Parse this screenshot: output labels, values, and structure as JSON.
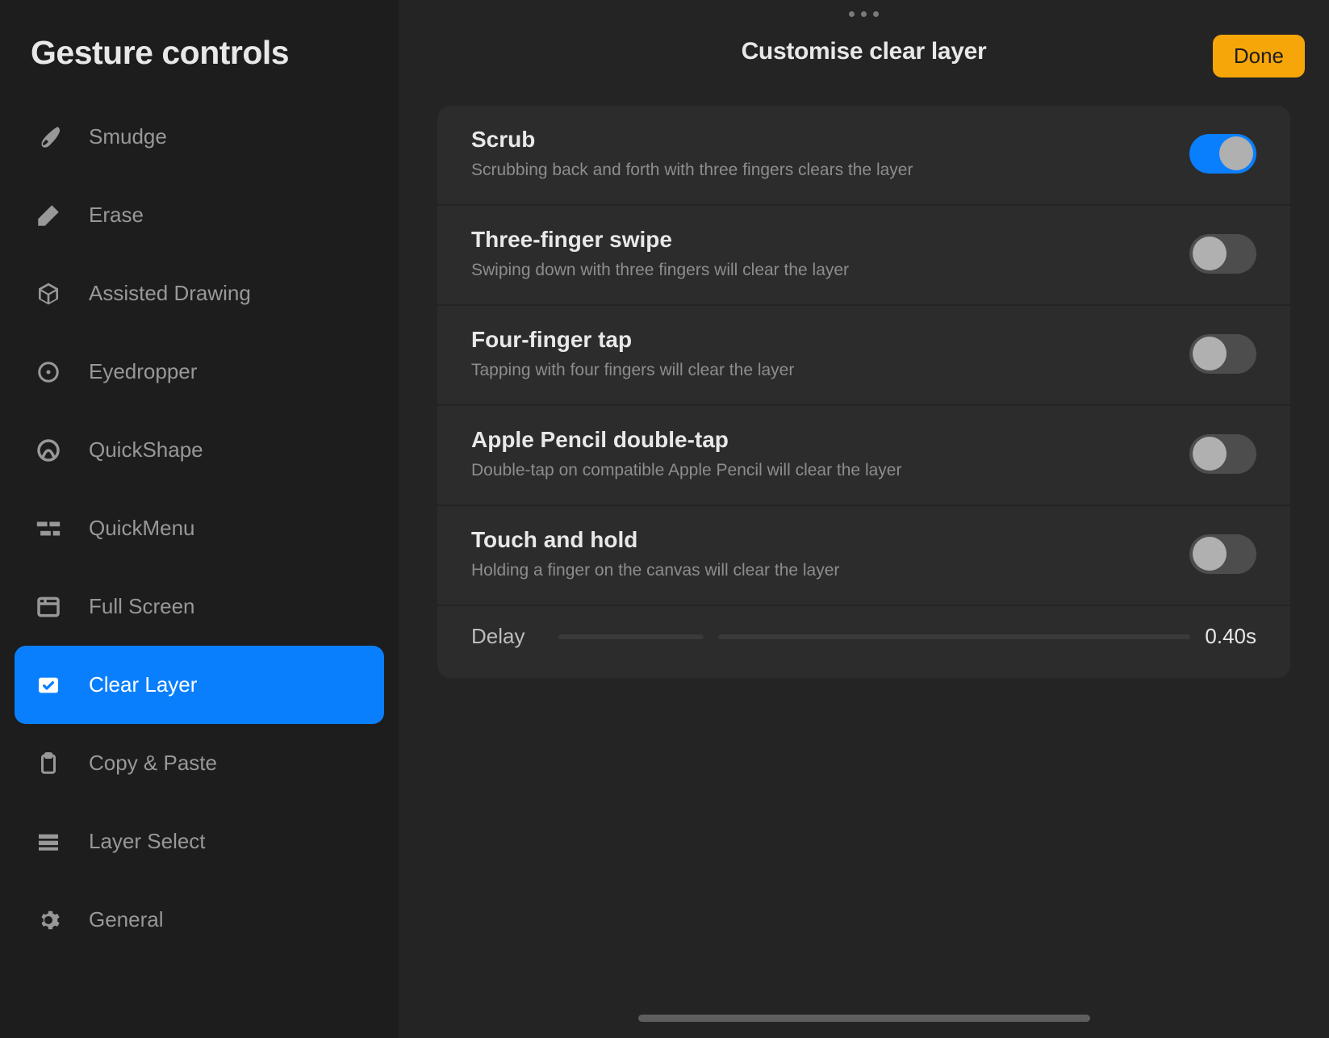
{
  "sidebar": {
    "title": "Gesture controls",
    "items": [
      {
        "id": "smudge",
        "label": "Smudge",
        "icon": "smudge-icon"
      },
      {
        "id": "erase",
        "label": "Erase",
        "icon": "erase-icon"
      },
      {
        "id": "assisted-drawing",
        "label": "Assisted Drawing",
        "icon": "cube-icon"
      },
      {
        "id": "eyedropper",
        "label": "Eyedropper",
        "icon": "eyedropper-icon"
      },
      {
        "id": "quickshape",
        "label": "QuickShape",
        "icon": "quickshape-icon"
      },
      {
        "id": "quickmenu",
        "label": "QuickMenu",
        "icon": "quickmenu-icon"
      },
      {
        "id": "full-screen",
        "label": "Full Screen",
        "icon": "fullscreen-icon"
      },
      {
        "id": "clear-layer",
        "label": "Clear Layer",
        "icon": "clear-layer-icon",
        "selected": true
      },
      {
        "id": "copy-paste",
        "label": "Copy & Paste",
        "icon": "clipboard-icon"
      },
      {
        "id": "layer-select",
        "label": "Layer Select",
        "icon": "layers-icon"
      },
      {
        "id": "general",
        "label": "General",
        "icon": "gear-icon"
      }
    ]
  },
  "main": {
    "title": "Customise clear layer",
    "done_label": "Done",
    "settings": [
      {
        "id": "scrub",
        "title": "Scrub",
        "desc": "Scrubbing back and forth with three fingers clears the layer",
        "enabled": true
      },
      {
        "id": "three-finger-swipe",
        "title": "Three-finger swipe",
        "desc": "Swiping down with three fingers will clear the layer",
        "enabled": false
      },
      {
        "id": "four-finger-tap",
        "title": "Four-finger tap",
        "desc": "Tapping with four fingers will clear the layer",
        "enabled": false
      },
      {
        "id": "pencil-double-tap",
        "title": "Apple Pencil double-tap",
        "desc": "Double-tap on compatible Apple Pencil will clear the layer",
        "enabled": false
      },
      {
        "id": "touch-hold",
        "title": "Touch and hold",
        "desc": "Holding a finger on the canvas will clear the layer",
        "enabled": false
      }
    ],
    "delay": {
      "label": "Delay",
      "value": "0.40s"
    }
  }
}
